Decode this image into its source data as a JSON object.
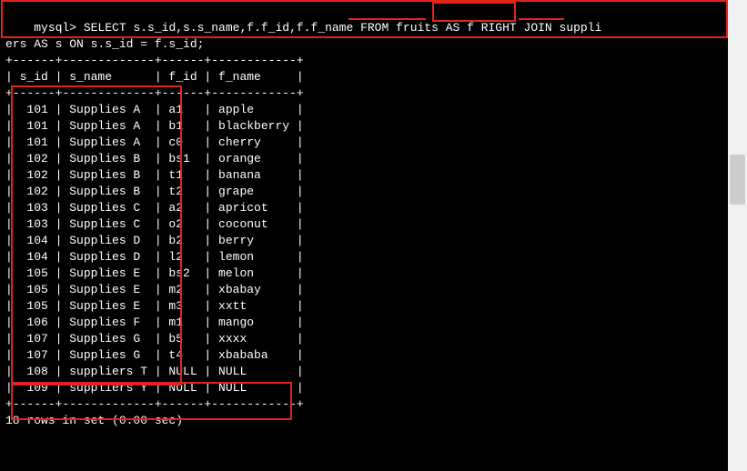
{
  "prompt": "mysql>",
  "query_line1": " SELECT s.s_id,s.s_name,f.f_id,f.f_name FROM fruits AS f RIGHT JOIN suppli",
  "query_line2": "ers AS s ON s.s_id = f.s_id;",
  "separator_top": "+------+-------------+------+------------+",
  "header_row": "| s_id | s_name      | f_id | f_name     |",
  "separator_header": "+------+-------------+------+------------+",
  "separator_bottom": "+------+-------------+------+------------+",
  "rows": [
    {
      "s_id": "101",
      "s_name": "Supplies A",
      "f_id": "a1",
      "f_name": "apple"
    },
    {
      "s_id": "101",
      "s_name": "Supplies A",
      "f_id": "b1",
      "f_name": "blackberry"
    },
    {
      "s_id": "101",
      "s_name": "Supplies A",
      "f_id": "c0",
      "f_name": "cherry"
    },
    {
      "s_id": "102",
      "s_name": "Supplies B",
      "f_id": "bs1",
      "f_name": "orange"
    },
    {
      "s_id": "102",
      "s_name": "Supplies B",
      "f_id": "t1",
      "f_name": "banana"
    },
    {
      "s_id": "102",
      "s_name": "Supplies B",
      "f_id": "t2",
      "f_name": "grape"
    },
    {
      "s_id": "103",
      "s_name": "Supplies C",
      "f_id": "a2",
      "f_name": "apricot"
    },
    {
      "s_id": "103",
      "s_name": "Supplies C",
      "f_id": "o2",
      "f_name": "coconut"
    },
    {
      "s_id": "104",
      "s_name": "Supplies D",
      "f_id": "b2",
      "f_name": "berry"
    },
    {
      "s_id": "104",
      "s_name": "Supplies D",
      "f_id": "l2",
      "f_name": "lemon"
    },
    {
      "s_id": "105",
      "s_name": "Supplies E",
      "f_id": "bs2",
      "f_name": "melon"
    },
    {
      "s_id": "105",
      "s_name": "Supplies E",
      "f_id": "m2",
      "f_name": "xbabay"
    },
    {
      "s_id": "105",
      "s_name": "Supplies E",
      "f_id": "m3",
      "f_name": "xxtt"
    },
    {
      "s_id": "106",
      "s_name": "Supplies F",
      "f_id": "m1",
      "f_name": "mango"
    },
    {
      "s_id": "107",
      "s_name": "Supplies G",
      "f_id": "b5",
      "f_name": "xxxx"
    },
    {
      "s_id": "107",
      "s_name": "Supplies G",
      "f_id": "t4",
      "f_name": "xbababa"
    },
    {
      "s_id": "108",
      "s_name": "suppliers T",
      "f_id": "NULL",
      "f_name": "NULL"
    },
    {
      "s_id": "109",
      "s_name": "suppliers Y",
      "f_id": "NULL",
      "f_name": "NULL"
    }
  ],
  "footer": "18 rows in set (0.00 sec)",
  "highlight_labels": {
    "fruits_as_f": "fruits AS f",
    "right_join": "RIGHT JOIN",
    "suppliers": "suppli"
  }
}
